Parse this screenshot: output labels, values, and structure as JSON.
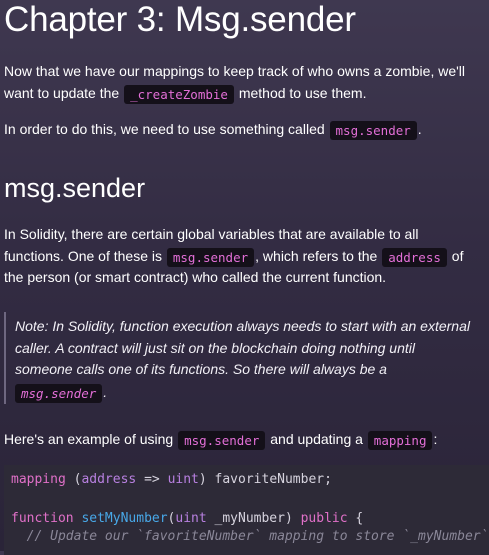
{
  "title": "Chapter 3: Msg.sender",
  "intro": {
    "line1": "Now that we have our mappings to keep track of who owns a zombie, we'll",
    "line2_pre": "want to update the ",
    "line2_code": "_createZombie",
    "line2_post": " method to use them."
  },
  "need": {
    "pre": "In order to do this, we need to use something called ",
    "code": "msg.sender",
    "post": "."
  },
  "section_title": "msg.sender",
  "solidity": {
    "line1": "In Solidity, there are certain global variables that are available to all",
    "line2_pre": "functions. One of these is ",
    "line2_code1": "msg.sender",
    "line2_mid": ", which refers to the ",
    "line2_code2": "address",
    "line2_post": " of",
    "line3": "the person (or smart contract) who called the current function."
  },
  "note": {
    "line1": "Note: In Solidity, function execution always needs to start with an external",
    "line2": "caller. A contract will just sit on the blockchain doing nothing until",
    "line3": "someone calls one of its functions. So there will always be a",
    "code": "msg.sender",
    "post": "."
  },
  "example": {
    "pre": "Here's an example of using ",
    "code1": "msg.sender",
    "mid": " and updating a ",
    "code2": "mapping",
    "post": ":"
  },
  "code_lines": {
    "l1_kw": "mapping",
    "l1_a": " (",
    "l1_t1": "address",
    "l1_b": " => ",
    "l1_t2": "uint",
    "l1_c": ") favoriteNumber;",
    "l3_kw": "function",
    "l3_sp": " ",
    "l3_fn": "setMyNumber",
    "l3_a": "(",
    "l3_t": "uint",
    "l3_b": " _myNumber) ",
    "l3_kw2": "public",
    "l3_c": " {",
    "l4_cm": "  // Update our `favoriteNumber` mapping to store `_myNumber`"
  },
  "colors": {
    "background_top": "#3f3850",
    "background_bottom": "#2a2438",
    "inline_code_bg": "#141019",
    "inline_code_text": "#e36fd7",
    "code_block_bg": "#2d2a37"
  }
}
